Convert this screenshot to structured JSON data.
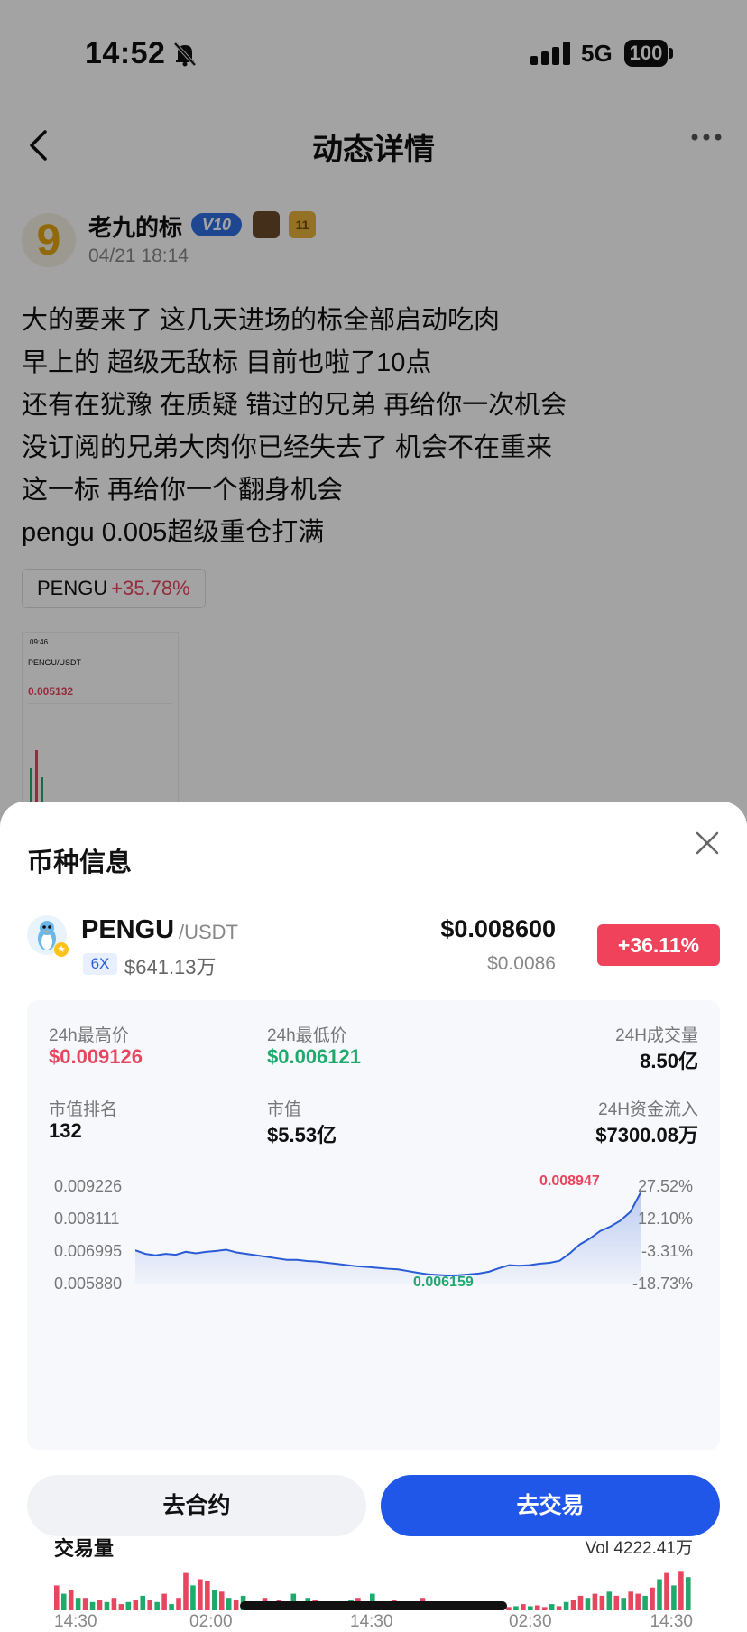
{
  "status": {
    "time": "14:52",
    "network": "5G",
    "battery": "100"
  },
  "nav": {
    "title": "动态详情"
  },
  "author": {
    "avatar_char": "9",
    "name": "老九的标",
    "vip": "V10",
    "level": "11",
    "time": "04/21 18:14"
  },
  "post": {
    "lines": [
      "大的要来了 这几天进场的标全部启动吃肉",
      "早上的 超级无敌标 目前也啦了10点",
      "还有在犹豫 在质疑 错过的兄弟 再给你一次机会",
      "没订阅的兄弟大肉你已经失去了 机会不在重来",
      "这一标 再给你一个翻身机会",
      "pengu 0.005超级重仓打满"
    ],
    "tag": {
      "symbol": "PENGU",
      "change": "+35.78%"
    }
  },
  "thumb": {
    "time": "09:46",
    "pair": "PENGU/USDT",
    "price": "0.005132"
  },
  "sheet": {
    "title": "币种信息",
    "coin": {
      "name": "PENGU",
      "pair": "/USDT",
      "leverage": "6X",
      "cap": "$641.13万",
      "price": "$0.008600",
      "price_sub": "$0.0086",
      "change": "+36.11%"
    },
    "stats": {
      "high_label": "24h最高价",
      "high_value": "$0.009126",
      "low_label": "24h最低价",
      "low_value": "$0.006121",
      "vol_label": "24H成交量",
      "vol_value": "8.50亿",
      "rank_label": "市值排名",
      "rank_value": "132",
      "mcap_label": "市值",
      "mcap_value": "$5.53亿",
      "flow_label": "24H资金流入",
      "flow_value": "$7300.08万"
    },
    "volume": {
      "title": "交易量",
      "value": "Vol 4222.41万"
    },
    "buttons": {
      "contract": "去合约",
      "trade": "去交易"
    }
  },
  "colors": {
    "up": "#e8455f",
    "down": "#1faa6b",
    "accent": "#2157e8",
    "line": "#2a5bd7"
  },
  "chart_data": [
    {
      "type": "line",
      "y_ticks": [
        "0.009226",
        "0.008111",
        "0.006995",
        "0.005880"
      ],
      "y2_ticks": [
        "27.52%",
        "12.10%",
        "-3.31%",
        "-18.73%"
      ],
      "ylim": [
        0.00588,
        0.009226
      ],
      "high_label": "0.008947",
      "low_label": "0.006159",
      "values": [
        0.007,
        0.00688,
        0.00683,
        0.00688,
        0.00685,
        0.00695,
        0.0069,
        0.00695,
        0.00698,
        0.00702,
        0.00693,
        0.00688,
        0.00683,
        0.00678,
        0.00673,
        0.00668,
        0.00668,
        0.00664,
        0.00662,
        0.00658,
        0.00654,
        0.0065,
        0.00646,
        0.00644,
        0.00641,
        0.00638,
        0.00636,
        0.0063,
        0.00624,
        0.00619,
        0.00617,
        0.00615,
        0.00616,
        0.00619,
        0.00622,
        0.00628,
        0.0064,
        0.0065,
        0.00648,
        0.0065,
        0.00655,
        0.00658,
        0.00665,
        0.0069,
        0.0072,
        0.0074,
        0.00765,
        0.0078,
        0.008,
        0.0083,
        0.00894
      ]
    },
    {
      "type": "bar",
      "title": "交易量",
      "x_ticks": [
        "14:30",
        "02:00",
        "14:30",
        "02:30",
        "14:30"
      ],
      "values": [
        0.6,
        0.4,
        0.5,
        0.3,
        0.3,
        0.2,
        0.25,
        0.2,
        0.3,
        0.15,
        0.2,
        0.25,
        0.35,
        0.25,
        0.2,
        0.4,
        0.15,
        0.3,
        0.9,
        0.6,
        0.75,
        0.7,
        0.5,
        0.45,
        0.3,
        0.25,
        0.35,
        0.2,
        0.15,
        0.3,
        0.2,
        0.25,
        0.15,
        0.4,
        0.2,
        0.3,
        0.25,
        0.15,
        0.2,
        0.1,
        0.15,
        0.25,
        0.3,
        0.2,
        0.4,
        0.15,
        0.1,
        0.25,
        0.2,
        0.1,
        0.15,
        0.3,
        0.12,
        0.1,
        0.05,
        0.08,
        0.15,
        0.1,
        0.05,
        0.05,
        0.1,
        0.08,
        0.05,
        0.08,
        0.1,
        0.15,
        0.1,
        0.12,
        0.08,
        0.15,
        0.1,
        0.2,
        0.25,
        0.35,
        0.3,
        0.4,
        0.35,
        0.45,
        0.35,
        0.3,
        0.45,
        0.4,
        0.35,
        0.55,
        0.75,
        0.9,
        0.6,
        0.95,
        0.8
      ],
      "up": [
        1,
        0,
        1,
        0,
        1,
        0,
        1,
        0,
        1,
        1,
        0,
        1,
        0,
        1,
        0,
        1,
        0,
        1,
        1,
        0,
        1,
        1,
        0,
        1,
        0,
        1,
        0,
        1,
        0,
        1,
        0,
        1,
        0,
        0,
        1,
        0,
        1,
        0,
        1,
        0,
        1,
        0,
        1,
        0,
        0,
        1,
        0,
        1,
        0,
        1,
        0,
        1,
        0,
        1,
        0,
        1,
        0,
        1,
        0,
        1,
        0,
        1,
        0,
        1,
        0,
        1,
        0,
        1,
        1,
        0,
        1,
        0,
        1,
        1,
        0,
        1,
        1,
        0,
        1,
        0,
        1,
        1,
        0,
        1,
        0,
        1,
        0,
        1,
        0
      ]
    }
  ]
}
